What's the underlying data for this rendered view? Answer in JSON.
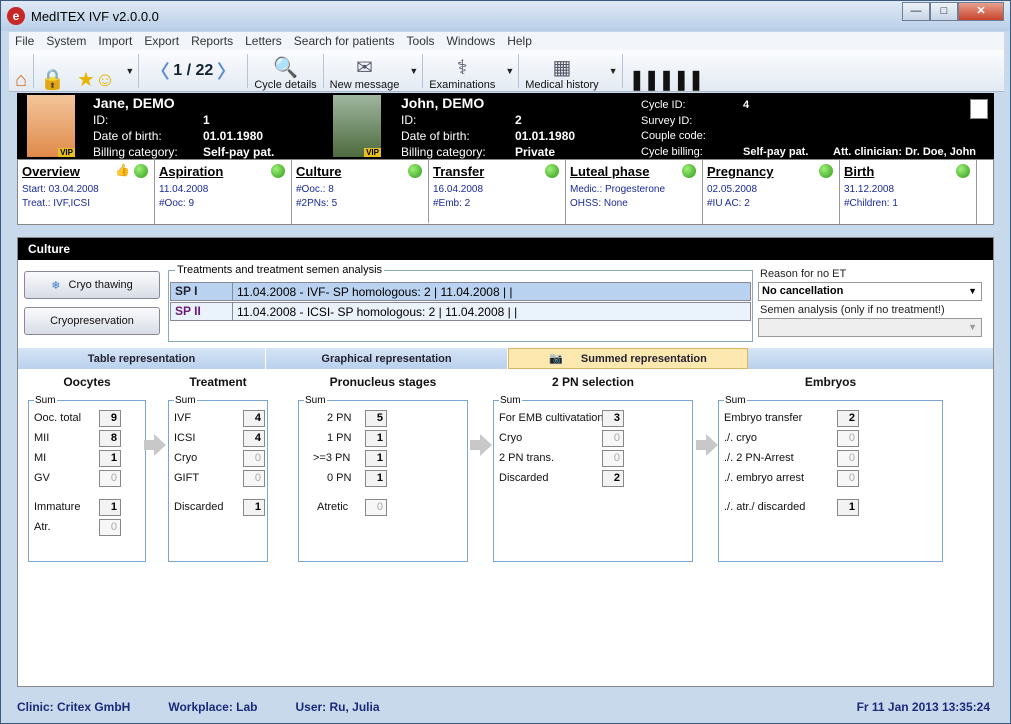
{
  "window": {
    "title": "MedITEX IVF v2.0.0.0"
  },
  "menu": [
    "File",
    "System",
    "Import",
    "Export",
    "Reports",
    "Letters",
    "Search for patients",
    "Tools",
    "Windows",
    "Help"
  ],
  "toolbar": {
    "pager": "1 / 22",
    "cycle_details": "Cycle details",
    "new_message": "New message",
    "examinations": "Examinations",
    "medical_history": "Medical history"
  },
  "female": {
    "name": "Jane, DEMO",
    "id_label": "ID:",
    "id": "1",
    "dob_label": "Date of birth:",
    "dob": "01.01.1980",
    "billing_label": "Billing category:",
    "billing": "Self-pay pat.",
    "vip": "VIP"
  },
  "male": {
    "name": "John, DEMO",
    "id_label": "ID:",
    "id": "2",
    "dob_label": "Date of birth:",
    "dob": "01.01.1980",
    "billing_label": "Billing category:",
    "billing": "Private",
    "vip": "VIP"
  },
  "cycle": {
    "cycle_id_label": "Cycle ID:",
    "cycle_id": "4",
    "survey_label": "Survey ID:",
    "couple_label": "Couple code:",
    "billing_label": "Cycle billing:",
    "billing": "Self-pay pat.",
    "clinician": "Att. clinician: Dr. Doe, John"
  },
  "phases": [
    {
      "title": "Overview",
      "l1": "Start: 03.04.2008",
      "l2": "Treat.: IVF,ICSI"
    },
    {
      "title": "Aspiration",
      "l1": "11.04.2008",
      "l2": "#Ooc: 9"
    },
    {
      "title": "Culture",
      "l1": "#Ooc.: 8",
      "l2": "#2PNs: 5"
    },
    {
      "title": "Transfer",
      "l1": "16.04.2008",
      "l2": "#Emb: 2"
    },
    {
      "title": "Luteal phase",
      "l1": "Medic.: Progesterone",
      "l2": "OHSS: None"
    },
    {
      "title": "Pregnancy",
      "l1": "02.05.2008",
      "l2": "#IU AC:  2"
    },
    {
      "title": "Birth",
      "l1": "31.12.2008",
      "l2": "#Children: 1"
    }
  ],
  "culture": {
    "header": "Culture",
    "cryo_thawing": "Cryo thawing",
    "cryopreservation": "Cryopreservation",
    "group_caption": "Treatments and treatment semen analysis",
    "rows": [
      {
        "a": "SP I",
        "b": "11.04.2008 - IVF- SP homologous: 2 | 11.04.2008 |  |"
      },
      {
        "a": "SP II",
        "b": "11.04.2008 - ICSI- SP homologous: 2 | 11.04.2008 |  |"
      }
    ],
    "reason_label": "Reason for no ET",
    "reason_value": "No cancellation",
    "semen_label": "Semen analysis (only if no treatment!)"
  },
  "view_tabs": [
    "Table representation",
    "Graphical representation",
    "Summed representation"
  ],
  "sum_label": "Sum",
  "sections": [
    {
      "title": "Oocytes",
      "items": [
        {
          "l": "Ooc. total",
          "v": "9"
        },
        {
          "l": "MII",
          "v": "8"
        },
        {
          "l": "MI",
          "v": "1"
        },
        {
          "l": "GV",
          "v": "0"
        },
        {
          "l": "Immature",
          "v": "1"
        },
        {
          "l": "Atr.",
          "v": "0"
        }
      ]
    },
    {
      "title": "Treatment",
      "items": [
        {
          "l": "IVF",
          "v": "4"
        },
        {
          "l": "ICSI",
          "v": "4"
        },
        {
          "l": "Cryo",
          "v": "0"
        },
        {
          "l": "GIFT",
          "v": "0"
        },
        {
          "l": "Discarded",
          "v": "1"
        }
      ]
    },
    {
      "title": "Pronucleus stages",
      "items": [
        {
          "l": "2 PN",
          "v": "5"
        },
        {
          "l": "1 PN",
          "v": "1"
        },
        {
          "l": ">=3 PN",
          "v": "1"
        },
        {
          "l": "0 PN",
          "v": "1"
        },
        {
          "l": "Atretic",
          "v": "0"
        }
      ]
    },
    {
      "title": "2 PN selection",
      "items": [
        {
          "l": "For EMB cultivatation",
          "v": "3"
        },
        {
          "l": "Cryo",
          "v": "0"
        },
        {
          "l": "2 PN trans.",
          "v": "0"
        },
        {
          "l": "Discarded",
          "v": "2"
        }
      ]
    },
    {
      "title": "Embryos",
      "items": [
        {
          "l": "Embryo transfer",
          "v": "2"
        },
        {
          "l": "./. cryo",
          "v": "0"
        },
        {
          "l": "./. 2 PN-Arrest",
          "v": "0"
        },
        {
          "l": "./. embryo arrest",
          "v": "0"
        },
        {
          "l": "./. atr./ discarded",
          "v": "1"
        }
      ]
    }
  ],
  "status": {
    "clinic": "Clinic: Critex GmbH",
    "workplace": "Workplace: Lab",
    "user": "User: Ru, Julia",
    "datetime": "Fr 11 Jan 2013 13:35:24"
  }
}
